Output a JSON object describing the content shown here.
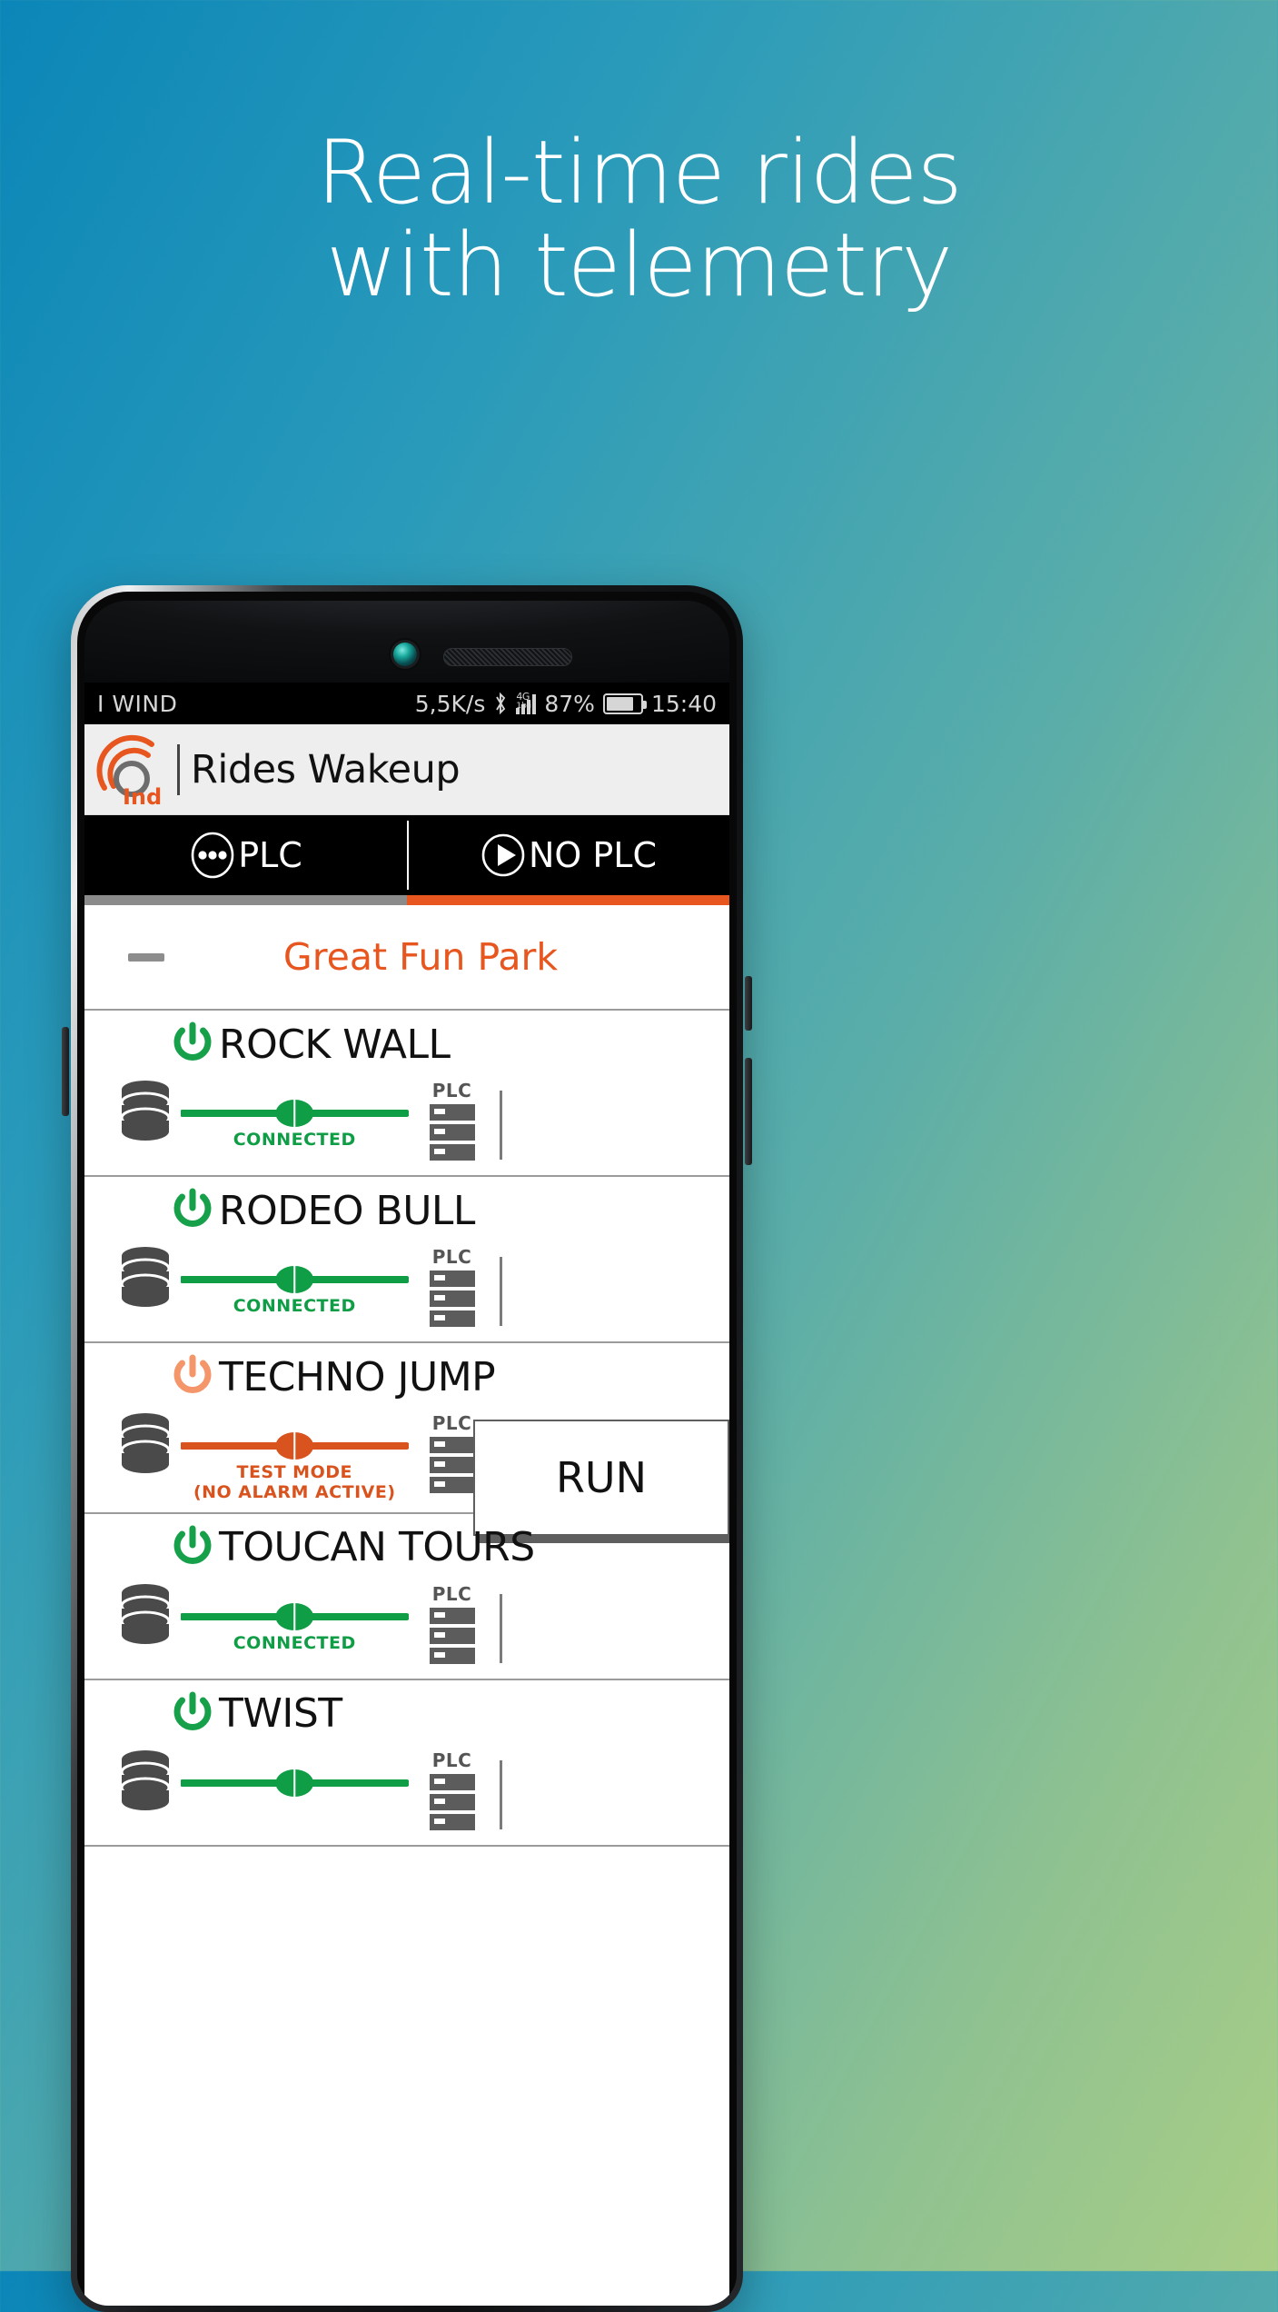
{
  "promo": {
    "headline_line1": "Real-time rides",
    "headline_line2": "with telemetry"
  },
  "phone": {
    "statusbar": {
      "carrier": "I WIND",
      "net_speed": "5,5K/s",
      "bluetooth_icon": "bluetooth-icon",
      "network_type": "4G",
      "network_sub": "1b.il",
      "battery_percent": "87%",
      "battery_icon": "battery-icon",
      "clock": "15:40"
    },
    "appbar": {
      "logo_icon": "ind-logo-icon",
      "logo_text": "Ind",
      "title": "Rides Wakeup"
    },
    "tabs": {
      "items": [
        {
          "label": "PLC",
          "icon": "three-dots-circle-icon",
          "selected": false
        },
        {
          "label": "NO PLC",
          "icon": "play-circle-icon",
          "selected": true
        }
      ],
      "indicator_inactive_color": "#8b8b8b",
      "indicator_active_color": "#e8561f"
    },
    "park": {
      "name": "Great Fun Park",
      "collapse_icon": "minus-collapse-icon",
      "name_color": "#e8561f"
    },
    "plc_label": "PLC",
    "rides": [
      {
        "name": "ROCK WALL",
        "power_icon": "power-icon",
        "power_color": "#17a04a",
        "db_icon": "database-icon",
        "link_color": "#0f9d45",
        "status": "CONNECTED",
        "status_line2": "",
        "status_color": "#0f9d45",
        "action_label": ""
      },
      {
        "name": "RODEO BULL",
        "power_icon": "power-icon",
        "power_color": "#17a04a",
        "db_icon": "database-icon",
        "link_color": "#0f9d45",
        "status": "CONNECTED",
        "status_line2": "",
        "status_color": "#0f9d45",
        "action_label": ""
      },
      {
        "name": "TECHNO JUMP",
        "power_icon": "power-icon",
        "power_color": "#f4956a",
        "db_icon": "database-icon",
        "link_color": "#d9531e",
        "status": "TEST MODE",
        "status_line2": "(NO ALARM ACTIVE)",
        "status_color": "#d9531e",
        "action_label": "RUN"
      },
      {
        "name": "TOUCAN TOURS",
        "power_icon": "power-icon",
        "power_color": "#17a04a",
        "db_icon": "database-icon",
        "link_color": "#0f9d45",
        "status": "CONNECTED",
        "status_line2": "",
        "status_color": "#0f9d45",
        "action_label": ""
      },
      {
        "name": "TWIST",
        "power_icon": "power-icon",
        "power_color": "#17a04a",
        "db_icon": "database-icon",
        "link_color": "#0f9d45",
        "status": "",
        "status_line2": "",
        "status_color": "#0f9d45",
        "action_label": ""
      }
    ]
  }
}
